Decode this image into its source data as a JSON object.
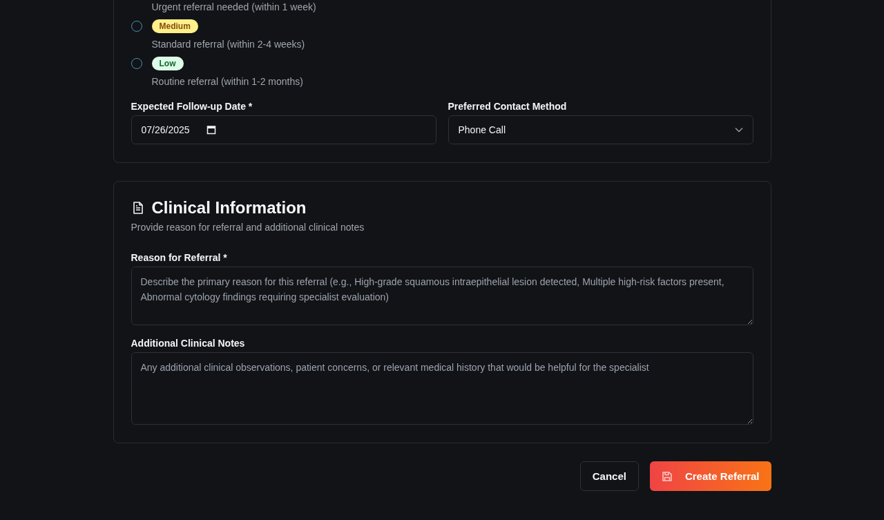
{
  "priority": {
    "partial_description": "Urgent referral needed (within 1 week)",
    "options": [
      {
        "badge": "Medium",
        "kind": "medium",
        "description": "Standard referral (within 2-4 weeks)",
        "selected": false
      },
      {
        "badge": "Low",
        "kind": "low",
        "description": "Routine referral (within 1-2 months)",
        "selected": false
      }
    ]
  },
  "follow_up": {
    "label": "Expected Follow-up Date *",
    "value": "07/26/2025"
  },
  "contact_method": {
    "label": "Preferred Contact Method",
    "value": "Phone Call"
  },
  "clinical": {
    "title": "Clinical Information",
    "subtitle": "Provide reason for referral and additional clinical notes",
    "fields": [
      {
        "label": "Reason for Referral *",
        "placeholder": "Describe the primary reason for this referral (e.g., High-grade squamous intraepithelial lesion detected, Multiple high-risk factors present, Abnormal cytology findings requiring specialist evaluation)"
      },
      {
        "label": "Additional Clinical Notes",
        "placeholder": "Any additional clinical observations, patient concerns, or relevant medical history that would be helpful for the specialist"
      }
    ]
  },
  "buttons": {
    "cancel": "Cancel",
    "submit": "Create Referral"
  }
}
